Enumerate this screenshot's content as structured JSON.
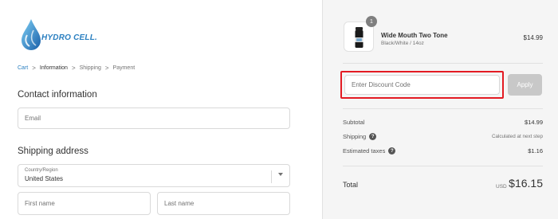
{
  "brand": {
    "name": "HYDRO CELL."
  },
  "breadcrumb": {
    "items": [
      {
        "label": "Cart",
        "state": "link"
      },
      {
        "label": "Information",
        "state": "current"
      },
      {
        "label": "Shipping",
        "state": "upcoming"
      },
      {
        "label": "Payment",
        "state": "upcoming"
      }
    ],
    "separator": ">"
  },
  "contact": {
    "title": "Contact information",
    "email_placeholder": "Email"
  },
  "shipping": {
    "title": "Shipping address",
    "country_label": "Country/Region",
    "country_value": "United States",
    "first_name_placeholder": "First name",
    "last_name_placeholder": "Last name"
  },
  "summary": {
    "product": {
      "quantity": "1",
      "name": "Wide Mouth Two Tone",
      "variant": "Black/White / 14oz",
      "price": "$14.99"
    },
    "discount": {
      "placeholder": "Enter Discount Code",
      "apply_label": "Apply"
    },
    "rows": {
      "subtotal_label": "Subtotal",
      "subtotal_value": "$14.99",
      "shipping_label": "Shipping",
      "shipping_value": "Calculated at next step",
      "taxes_label": "Estimated taxes",
      "taxes_value": "$1.16"
    },
    "total": {
      "label": "Total",
      "currency": "USD",
      "value": "$16.15"
    }
  },
  "colors": {
    "accent": "#2a7fc0",
    "highlight_border": "#e31b23",
    "summary_bg": "#f5f5f5"
  }
}
